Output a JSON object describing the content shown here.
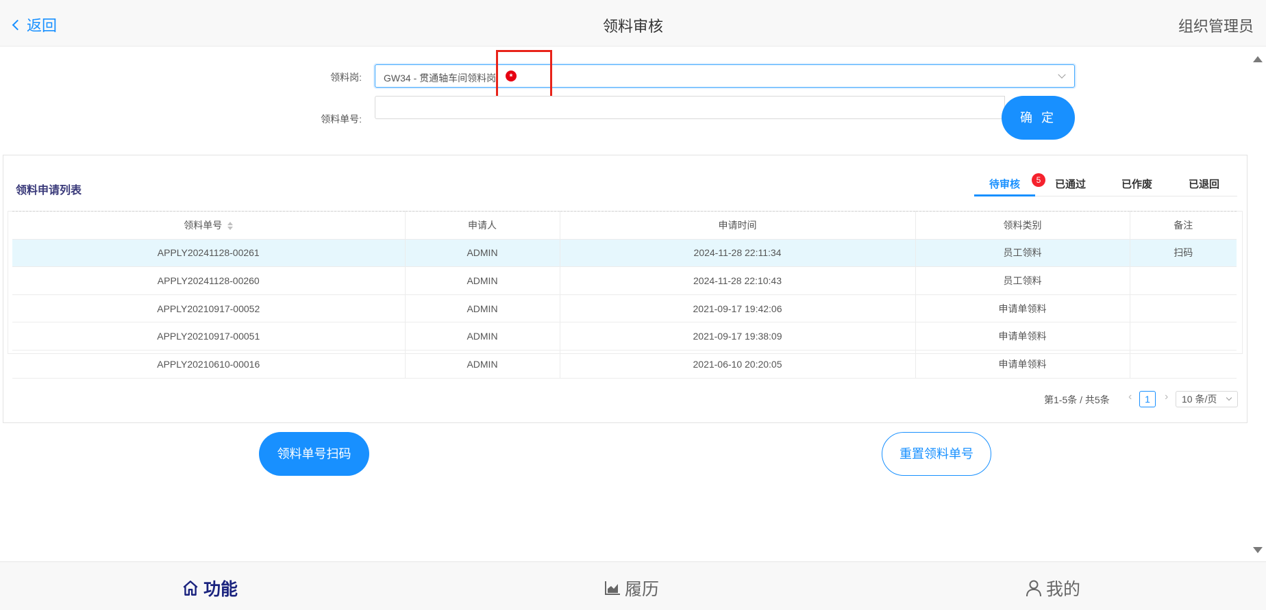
{
  "header": {
    "back_label": "返回",
    "title": "领料审核",
    "user_role": "组织管理员"
  },
  "form": {
    "post_label": "领料岗:",
    "post_value": "GW34 - 贯通轴车间领料岗",
    "required_mark": "*",
    "order_no_label": "领料单号:",
    "order_no_value": "",
    "confirm_label": "确 定"
  },
  "panel": {
    "title": "领料申请列表",
    "tabs": [
      {
        "label": "待审核",
        "badge": "5",
        "active": true
      },
      {
        "label": "已通过"
      },
      {
        "label": "已作废"
      },
      {
        "label": "已退回"
      }
    ]
  },
  "table": {
    "columns": [
      "领料单号",
      "申请人",
      "申请时间",
      "领料类别",
      "备注"
    ],
    "rows": [
      [
        "APPLY20241128-00261",
        "ADMIN",
        "2024-11-28 22:11:34",
        "员工领料",
        "扫码"
      ],
      [
        "APPLY20241128-00260",
        "ADMIN",
        "2024-11-28 22:10:43",
        "员工领料",
        ""
      ],
      [
        "APPLY20210917-00052",
        "ADMIN",
        "2021-09-17 19:42:06",
        "申请单领料",
        ""
      ],
      [
        "APPLY20210917-00051",
        "ADMIN",
        "2021-09-17 19:38:09",
        "申请单领料",
        ""
      ],
      [
        "APPLY20210610-00016",
        "ADMIN",
        "2021-06-10 20:20:05",
        "申请单领料",
        ""
      ]
    ]
  },
  "pagination": {
    "total_text": "第1-5条 / 共5条",
    "prev": "‹",
    "current_page": "1",
    "next": "›",
    "page_size": "10 条/页"
  },
  "actions": {
    "scan_label": "领料单号扫码",
    "reset_label": "重置领料单号"
  },
  "bottom_nav": {
    "items": [
      {
        "label": "功能",
        "icon": "home-icon",
        "active": true
      },
      {
        "label": "履历",
        "icon": "chart-icon"
      },
      {
        "label": "我的",
        "icon": "user-icon"
      }
    ]
  },
  "colors": {
    "primary": "#1890ff",
    "badge_red": "#f5222d",
    "highlight_red": "#e8231a",
    "nav_active": "#1a237e"
  }
}
